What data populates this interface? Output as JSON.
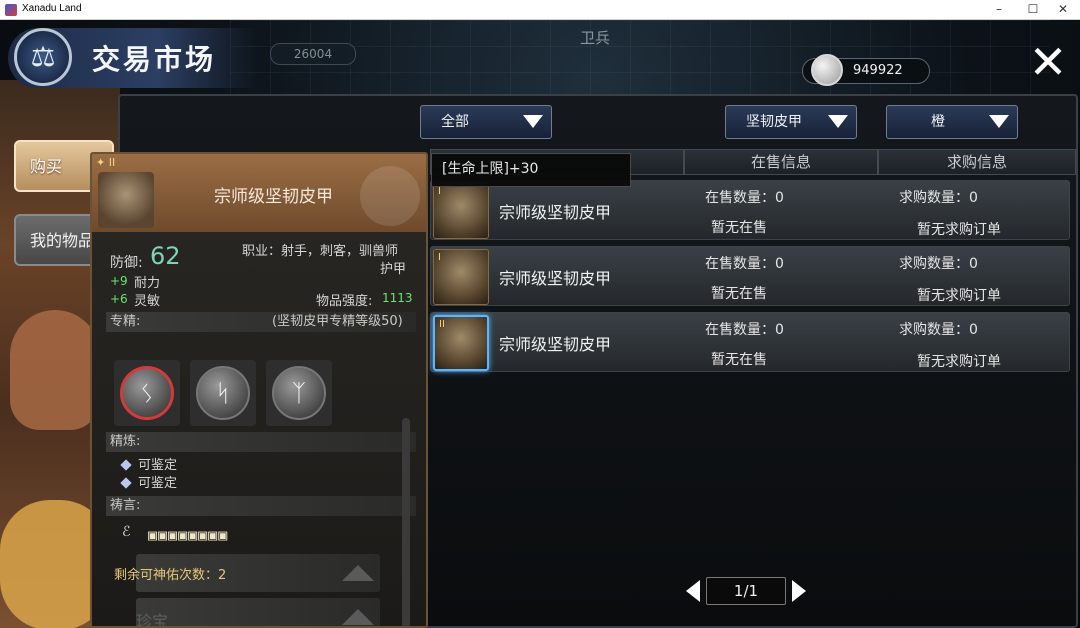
{
  "window": {
    "title": "Xanadu Land",
    "minimize": "–",
    "maximize": "☐",
    "close": "✕"
  },
  "header": {
    "title": "交易市场",
    "logo_icon": "scales-icon",
    "close_glyph": "✕"
  },
  "currency": {
    "amount": "949922",
    "icon": "silver-coin-icon"
  },
  "background": {
    "badges": [
      "26004",
      "卫兵"
    ]
  },
  "filters": {
    "category": "全部",
    "type": "坚韧皮甲",
    "quality": "橙"
  },
  "columns": {
    "sale": "在售信息",
    "buy": "求购信息"
  },
  "side_tabs": {
    "buy": "购买",
    "my_items": "我的物品"
  },
  "listings": [
    {
      "tier": "I",
      "name": "宗师级坚韧皮甲",
      "on_sale_count": "在售数量：0",
      "on_sale_status": "暂无在售",
      "buy_count": "求购数量：0",
      "buy_status": "暂无求购订单"
    },
    {
      "tier": "I",
      "name": "宗师级坚韧皮甲",
      "on_sale_count": "在售数量：0",
      "on_sale_status": "暂无在售",
      "buy_count": "求购数量：0",
      "buy_status": "暂无求购订单"
    },
    {
      "tier": "II",
      "name": "宗师级坚韧皮甲",
      "on_sale_count": "在售数量：0",
      "on_sale_status": "暂无在售",
      "buy_count": "求购数量：0",
      "buy_status": "暂无求购订单"
    }
  ],
  "pager": {
    "label": "1/1"
  },
  "stat_popup": "[生命上限]+30",
  "tooltip": {
    "tier": "II",
    "name": "宗师级坚韧皮甲",
    "defense_label": "防御:",
    "defense_value": "62",
    "classes": "职业：射手，刺客，驯兽师",
    "armor_type": "护甲",
    "bonus1_value": "+9",
    "bonus1_stat": "耐力",
    "bonus2_value": "+6",
    "bonus2_stat": "灵敏",
    "strength_label": "物品强度:",
    "strength_value": "1113",
    "mastery_label": "专精:",
    "mastery_level": "(坚韧皮甲专精等级50)",
    "skills": [
      "skill-rune-1-icon",
      "skill-rune-2-icon",
      "skill-rune-3-icon"
    ],
    "refine_label": "精炼:",
    "refine_items": [
      "可鉴定",
      "可鉴定"
    ],
    "prayer_label": "祷言:",
    "prayer_runes": "▣▣▣▣▣▣▣▣",
    "blessings_left": "剩余可神佑次数：2",
    "treasure_label": "珍宝"
  }
}
